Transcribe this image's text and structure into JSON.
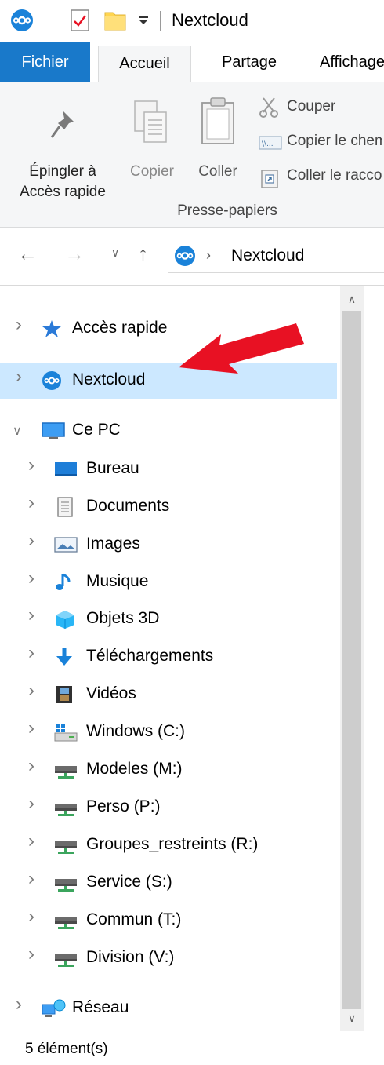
{
  "window": {
    "title": "Nextcloud"
  },
  "ribbon": {
    "tabs": [
      {
        "label": "Fichier"
      },
      {
        "label": "Accueil"
      },
      {
        "label": "Partage"
      },
      {
        "label": "Affichage"
      }
    ],
    "pin_label_1": "Épingler à",
    "pin_label_2": "Accès rapide",
    "copy_label": "Copier",
    "paste_label": "Coller",
    "cut_label": "Couper",
    "copy_path_label": "Copier le chemin d'accès",
    "paste_shortcut_label": "Coller le raccourci",
    "group_label": "Presse-papiers"
  },
  "address": {
    "location": "Nextcloud",
    "separator": "›"
  },
  "tree": {
    "items": [
      {
        "label": "Accès rapide",
        "icon": "star-pin-icon"
      },
      {
        "label": "Nextcloud",
        "icon": "nextcloud-icon",
        "selected": true
      },
      {
        "label": "Ce PC",
        "icon": "computer-icon",
        "expanded": true
      },
      {
        "label": "Bureau",
        "icon": "desktop-icon"
      },
      {
        "label": "Documents",
        "icon": "documents-icon"
      },
      {
        "label": "Images",
        "icon": "images-icon"
      },
      {
        "label": "Musique",
        "icon": "music-icon"
      },
      {
        "label": "Objets 3D",
        "icon": "cube-icon"
      },
      {
        "label": "Téléchargements",
        "icon": "download-icon"
      },
      {
        "label": "Vidéos",
        "icon": "video-icon"
      },
      {
        "label": "Windows (C:)",
        "icon": "windows-drive-icon"
      },
      {
        "label": "Modeles (M:)",
        "icon": "network-drive-icon"
      },
      {
        "label": "Perso (P:)",
        "icon": "network-drive-icon"
      },
      {
        "label": "Groupes_restreints (R:)",
        "icon": "network-drive-icon"
      },
      {
        "label": "Service (S:)",
        "icon": "network-drive-icon"
      },
      {
        "label": "Commun (T:)",
        "icon": "network-drive-icon"
      },
      {
        "label": "Division (V:)",
        "icon": "network-drive-icon"
      },
      {
        "label": "Réseau",
        "icon": "network-icon"
      }
    ]
  },
  "status": {
    "count": "5 élément(s)"
  },
  "colors": {
    "accent": "#1979ca",
    "selection": "#cce8ff",
    "arrow": "#e81123"
  }
}
